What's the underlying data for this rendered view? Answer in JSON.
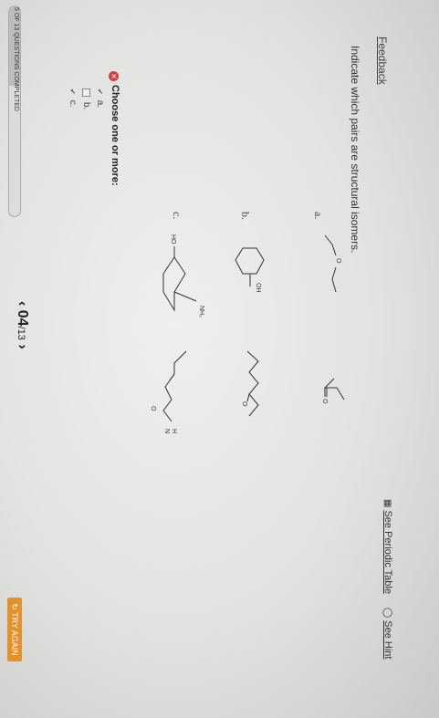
{
  "header": {
    "feedback_link": "Feedback",
    "periodic_table_link": "See Periodic Table",
    "hint_link": "See Hint"
  },
  "question": {
    "prompt": "Indicate which pairs are structural isomers.",
    "labels": [
      "a.",
      "b.",
      "c."
    ],
    "atom_labels": {
      "o_ether": "O",
      "o_ketone_a": "O",
      "oh": "OH",
      "o_ketone_b": "O",
      "ho": "HO",
      "nh2": "NH₂",
      "o_amide": "O",
      "h_amide": "H",
      "n_amide": "N"
    }
  },
  "answer": {
    "instruction": "Choose one or more:",
    "options": [
      {
        "label": "a.",
        "checked": true
      },
      {
        "label": "b.",
        "checked": false
      },
      {
        "label": "c.",
        "checked": true
      }
    ]
  },
  "footer": {
    "progress_text": "5 OF 13 QUESTIONS COMPLETED",
    "progress_fraction": 0.38,
    "nav_prev": "‹",
    "nav_current": "04",
    "nav_total": "/13",
    "nav_next": "›",
    "try_again": "TRY AGAIN"
  },
  "colors": {
    "try_again_bg": "#e3912e",
    "error_mark": "#d63e3e"
  },
  "icons": [
    "periodic-table-icon",
    "hint-bulb-icon",
    "error-x-icon",
    "check-icon",
    "refresh-icon"
  ]
}
